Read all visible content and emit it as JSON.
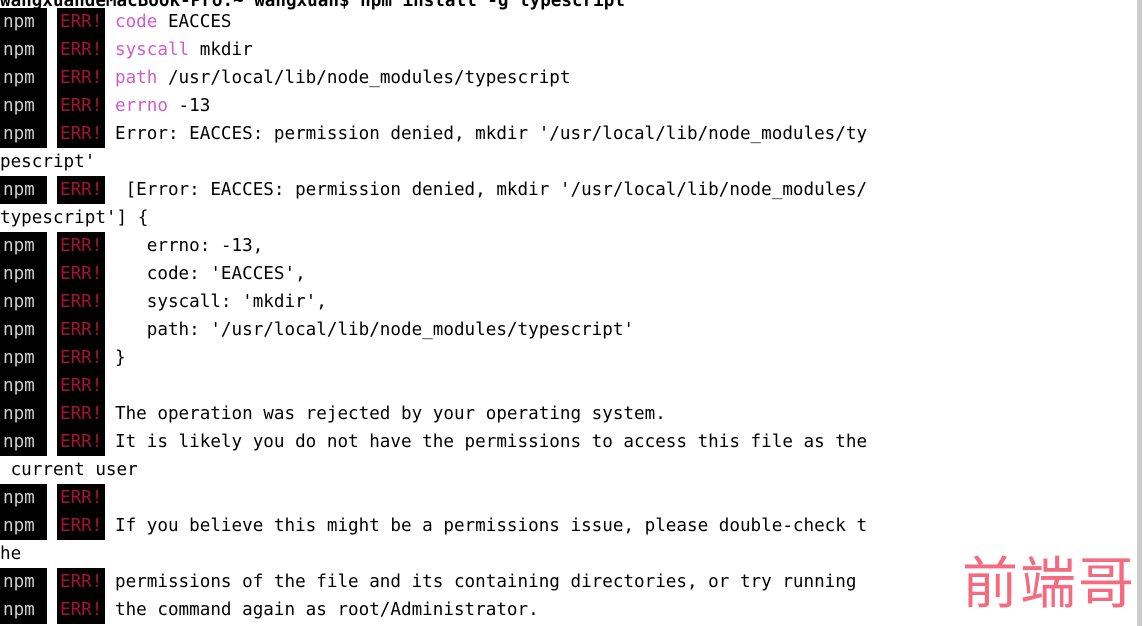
{
  "terminal": {
    "prompt_line": "wangxuandeMacBook-Pro:~ wangxuan$ npm install -g typescript",
    "prefix_npm": "npm",
    "prefix_err": "ERR!",
    "colors": {
      "background": "#ffffff",
      "foreground": "#000000",
      "badge_background": "#000000",
      "npm_text": "#cfcfcf",
      "err_text": "#a81232",
      "keyword_magenta": "#cf5ccf",
      "watermark": "#f4647a",
      "edge_line": "#cdcdcd"
    },
    "watermark_text": "前端哥",
    "lines": [
      {
        "prefix": true,
        "keyword": "code",
        "text": " EACCES"
      },
      {
        "prefix": true,
        "keyword": "syscall",
        "text": " mkdir"
      },
      {
        "prefix": true,
        "keyword": "path",
        "text": " /usr/local/lib/node_modules/typescript"
      },
      {
        "prefix": true,
        "keyword": "errno",
        "text": " -13"
      },
      {
        "prefix": true,
        "keyword": "",
        "text": "Error: EACCES: permission denied, mkdir '/usr/local/lib/node_modules/ty"
      },
      {
        "prefix": false,
        "keyword": "",
        "text": "pescript'"
      },
      {
        "prefix": true,
        "keyword": "",
        "text": " [Error: EACCES: permission denied, mkdir '/usr/local/lib/node_modules/"
      },
      {
        "prefix": false,
        "keyword": "",
        "text": "typescript'] {"
      },
      {
        "prefix": true,
        "keyword": "",
        "text": "   errno: -13,"
      },
      {
        "prefix": true,
        "keyword": "",
        "text": "   code: 'EACCES',"
      },
      {
        "prefix": true,
        "keyword": "",
        "text": "   syscall: 'mkdir',"
      },
      {
        "prefix": true,
        "keyword": "",
        "text": "   path: '/usr/local/lib/node_modules/typescript'"
      },
      {
        "prefix": true,
        "keyword": "",
        "text": "}"
      },
      {
        "prefix": true,
        "keyword": "",
        "text": ""
      },
      {
        "prefix": true,
        "keyword": "",
        "text": "The operation was rejected by your operating system."
      },
      {
        "prefix": true,
        "keyword": "",
        "text": "It is likely you do not have the permissions to access this file as the"
      },
      {
        "prefix": false,
        "keyword": "",
        "text": " current user"
      },
      {
        "prefix": true,
        "keyword": "",
        "text": ""
      },
      {
        "prefix": true,
        "keyword": "",
        "text": "If you believe this might be a permissions issue, please double-check t"
      },
      {
        "prefix": false,
        "keyword": "",
        "text": "he"
      },
      {
        "prefix": true,
        "keyword": "",
        "text": "permissions of the file and its containing directories, or try running"
      },
      {
        "prefix": true,
        "keyword": "",
        "text": "the command again as root/Administrator."
      }
    ]
  }
}
